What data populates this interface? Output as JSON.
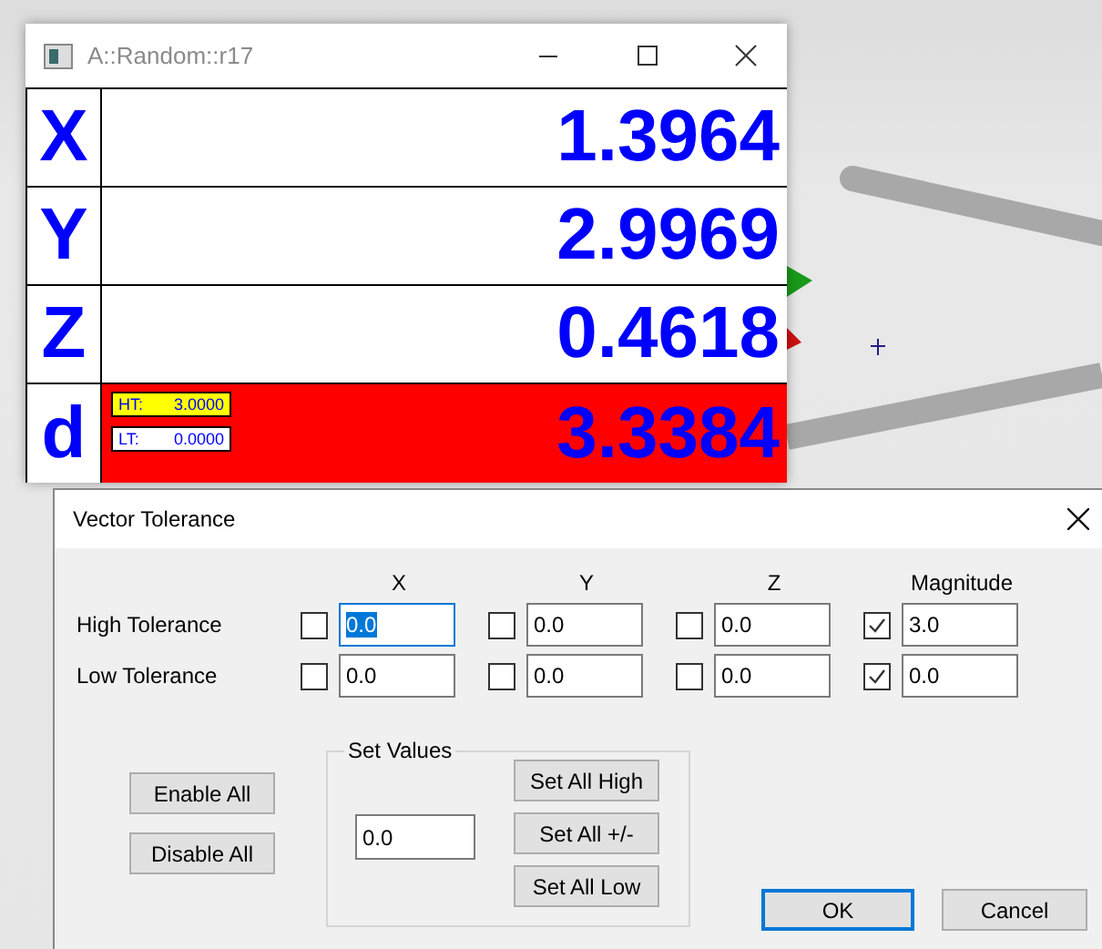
{
  "readout_window": {
    "title": "A::Random::r17",
    "rows": [
      {
        "label": "X",
        "value": "1.3964",
        "alarm": false
      },
      {
        "label": "Y",
        "value": "2.9969",
        "alarm": false
      },
      {
        "label": "Z",
        "value": "0.4618",
        "alarm": false
      },
      {
        "label": "d",
        "value": "3.3384",
        "alarm": true,
        "tags": [
          {
            "kind": "high",
            "label": "HT:",
            "value": "3.0000"
          },
          {
            "kind": "low",
            "label": "LT:",
            "value": "0.0000"
          }
        ]
      }
    ]
  },
  "dialog": {
    "title": "Vector Tolerance",
    "columns": [
      "X",
      "Y",
      "Z",
      "Magnitude"
    ],
    "rows": [
      {
        "label": "High Tolerance",
        "cells": [
          {
            "checked": false,
            "value": "0.0",
            "text_selected": true
          },
          {
            "checked": false,
            "value": "0.0",
            "text_selected": false
          },
          {
            "checked": false,
            "value": "0.0",
            "text_selected": false
          },
          {
            "checked": true,
            "value": "3.0",
            "text_selected": false
          }
        ]
      },
      {
        "label": "Low Tolerance",
        "cells": [
          {
            "checked": false,
            "value": "0.0",
            "text_selected": false
          },
          {
            "checked": false,
            "value": "0.0",
            "text_selected": false
          },
          {
            "checked": false,
            "value": "0.0",
            "text_selected": false
          },
          {
            "checked": true,
            "value": "0.0",
            "text_selected": false
          }
        ]
      }
    ],
    "toggle_buttons": [
      "Enable All",
      "Disable All"
    ],
    "set_values": {
      "title": "Set Values",
      "value": "0.0",
      "buttons": [
        "Set All High",
        "Set All +/-",
        "Set All Low"
      ]
    },
    "ok": "OK",
    "cancel": "Cancel"
  }
}
